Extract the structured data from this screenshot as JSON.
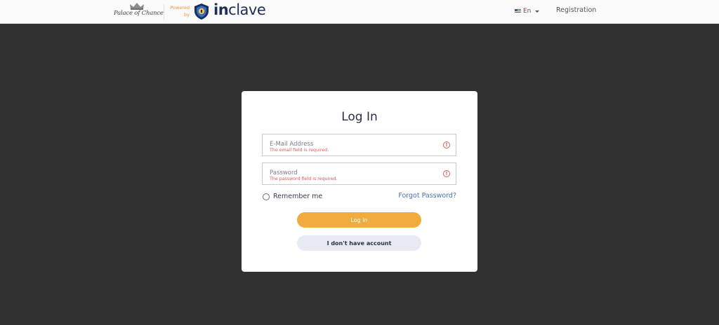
{
  "header": {
    "casino_logo_text": "Palace of Chance",
    "powered_by_line1": "Powered",
    "powered_by_line2": "by",
    "brand_bold": "in",
    "brand_rest": "clave",
    "language": "En",
    "registration_link": "Registration"
  },
  "login": {
    "title": "Log In",
    "email_label": "E-Mail Address",
    "email_error": "The email field is required.",
    "password_label": "Password",
    "password_error": "The password field is required.",
    "remember_label": "Remember me",
    "forgot_link": "Forgot Password?",
    "login_button": "Log in",
    "no_account_button": "I don't have account"
  },
  "icons": {
    "error": "!",
    "flag": "us-flag-icon",
    "dropdown": "chevron-down-icon"
  },
  "colors": {
    "accent": "#f0ac3e",
    "error": "#e25757",
    "link": "#4a6fb8",
    "brand": "#1d2d5a",
    "backdrop": "#313131"
  }
}
